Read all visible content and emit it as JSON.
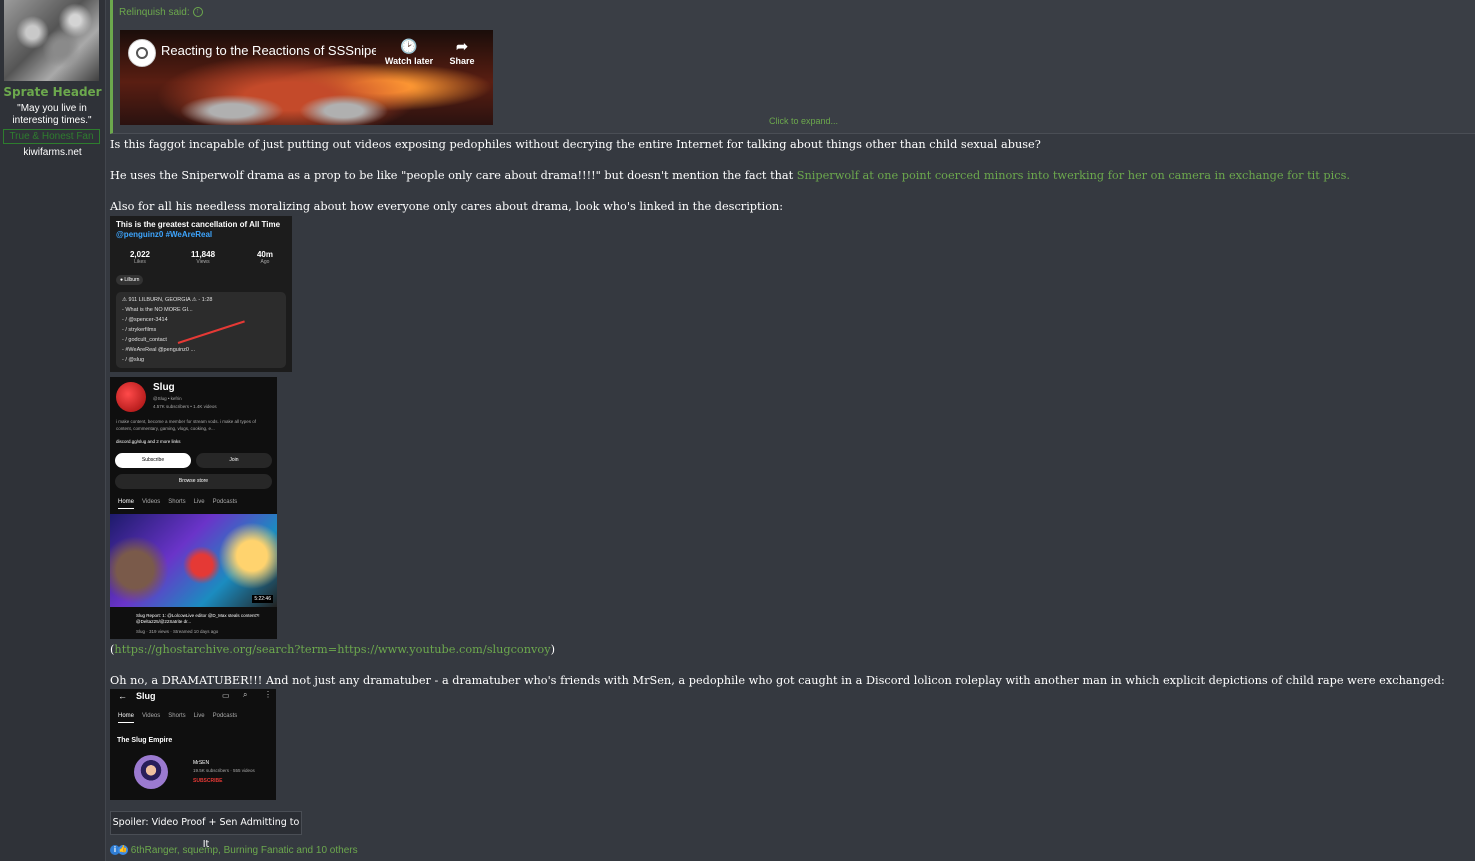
{
  "user": {
    "name": "Sprate Header",
    "quote": "\"May you live in interesting times.\"",
    "title": "True & Honest Fan",
    "site": "kiwifarms.net"
  },
  "quote": {
    "author": "Relinquish said:",
    "expand": "Click to expand..."
  },
  "video": {
    "title": "Reacting to the Reactions of SSSniper...",
    "watch_later": "Watch later",
    "share": "Share"
  },
  "post": {
    "p1": "Is this faggot incapable of just putting out videos exposing pedophiles without decrying the entire Internet for talking about things other than child sexual abuse?",
    "p2_before": "He uses the Sniperwolf drama as a prop to be like \"people only care about drama!!!!\" but doesn't mention the fact that ",
    "p2_link": "Sniperwolf at one point coerced minors into twerking for her on camera in exchange for tit pics.",
    "p3": "Also for all his needless moralizing about how everyone only cares about drama, look who's linked in the description:",
    "p4_open": "(",
    "p4_link": "https://ghostarchive.org/search?term=https://www.youtube.com/slugconvoy",
    "p4_close": ")",
    "p5": "Oh no, a DRAMATUBER!!! And not just any dramatuber - a dramatuber who's friends with MrSen, a pedophile who got caught in a Discord lolicon roleplay with another man in which explicit depictions of child rape were exchanged:",
    "spoiler": "Spoiler: Video Proof + Sen Admitting to It",
    "reactions": "6thRanger, squemp, Burning Fanatic and 10 others"
  },
  "shot1": {
    "title": "This is the greatest cancellation of All Time",
    "tags": "@penguinz0  #WeAreReal",
    "likes": "2,022",
    "likes_label": "Likes",
    "views": "11,848",
    "views_label": "Views",
    "ago": "40m",
    "ago_label": "Ago",
    "location": "Lilburn",
    "rows": [
      "⚠ 911 LILBURN, GEORGIA ⚠ - 1:28",
      "- What is the NO MORE GI...",
      "- / @spencer-3414",
      "- / strykerfilms",
      "- / godcult_contact",
      "- #WeAreReal @penguinz0 ...",
      "- / @slug"
    ]
  },
  "shot2": {
    "name": "Slug",
    "handle": "@Slug • kefrin",
    "subs": "4.57K subscribers • 1.4K videos",
    "about": "i make content, become a member for stream vods. i make all types of content, commentary, gaming, vlogs, cooking, e...",
    "links": "discord.gg/slug and 2 more links",
    "subscribe": "Subscribe",
    "join": "Join",
    "store": "Browse store",
    "tabs": [
      "Home",
      "Videos",
      "Shorts",
      "Live",
      "Podcasts"
    ],
    "duration": "5:22:46",
    "video_title": "Slug Report: 1: @LolcowLive editor @D_Max steals content?! @Delta225/@22Satrite dr...",
    "video_meta": "Slug · 319 views · Streamed 10 days ago"
  },
  "shot3": {
    "name": "Slug",
    "tabs": [
      "Home",
      "Videos",
      "Shorts",
      "Live",
      "Podcasts"
    ],
    "section": "The Slug Empire",
    "channel": "MrSEN",
    "channel_meta": "19.5K subscribers · 555 videos",
    "subscribe": "SUBSCRIBE"
  },
  "colors": {
    "accent": "#6ca84d",
    "background": "#353940",
    "quote_bg": "#3a3e45"
  }
}
